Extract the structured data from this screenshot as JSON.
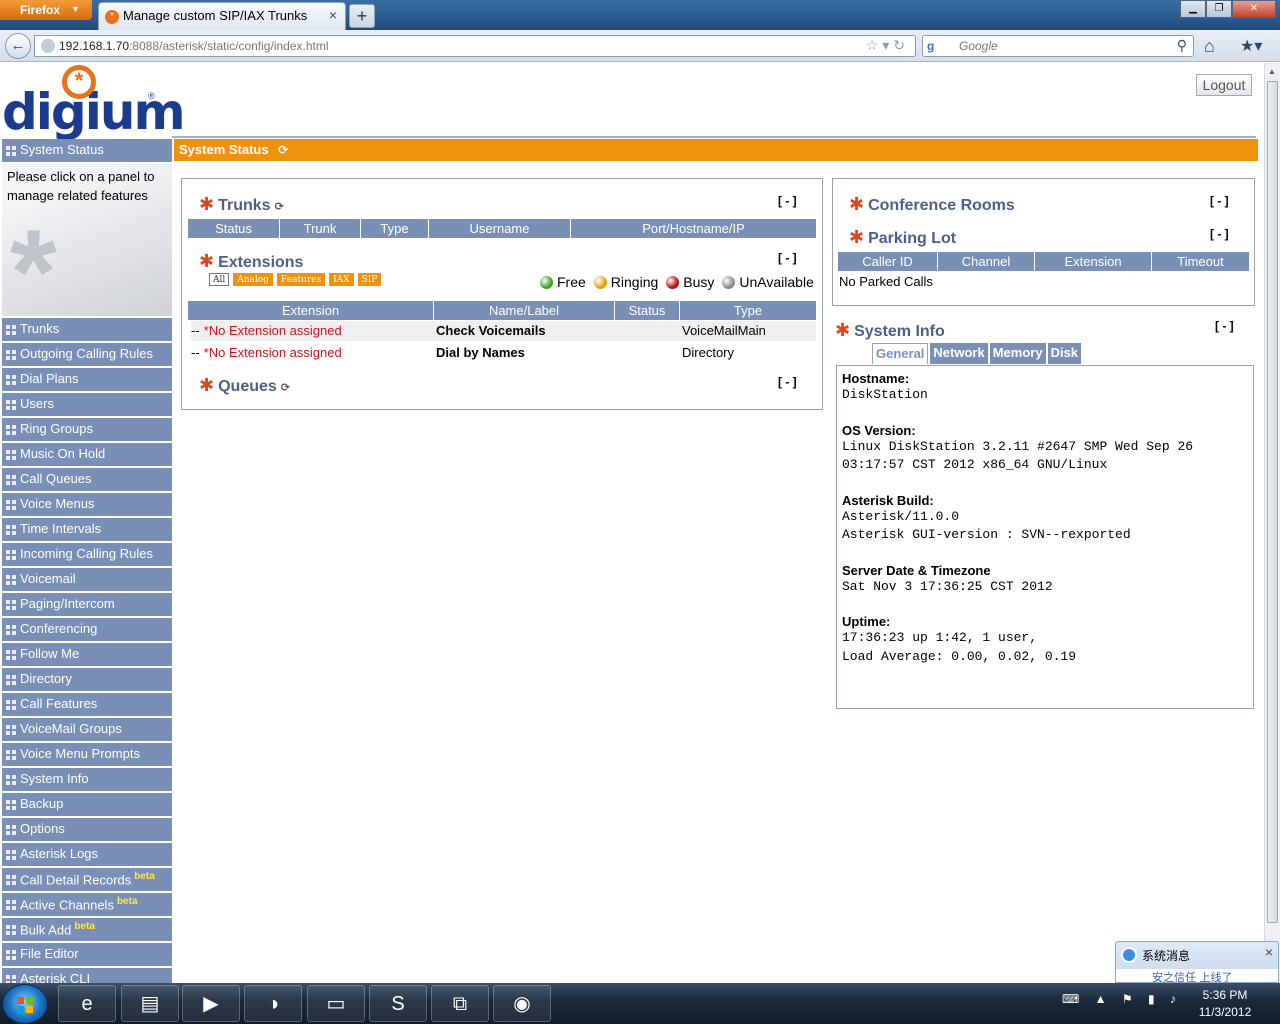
{
  "browser": {
    "menu_button": "Firefox",
    "tab_title": "Manage custom SIP/IAX Trunks",
    "url_host": "192.168.1.70",
    "url_rest": ":8088/asterisk/static/config/index.html",
    "search_placeholder": "Google",
    "search_engine_letter": "g"
  },
  "header": {
    "logo_text": "digium",
    "logout_label": "Logout"
  },
  "sidebar": {
    "active_item": "System Status",
    "help_text": "Please click on a panel to manage related features",
    "items": [
      {
        "label": "Trunks"
      },
      {
        "label": "Outgoing Calling Rules"
      },
      {
        "label": "Dial Plans"
      },
      {
        "label": "Users"
      },
      {
        "label": "Ring Groups"
      },
      {
        "label": "Music On Hold"
      },
      {
        "label": "Call Queues"
      },
      {
        "label": "Voice Menus"
      },
      {
        "label": "Time Intervals"
      },
      {
        "label": "Incoming Calling Rules"
      },
      {
        "label": "Voicemail"
      },
      {
        "label": "Paging/Intercom"
      },
      {
        "label": "Conferencing"
      },
      {
        "label": "Follow Me"
      },
      {
        "label": "Directory"
      },
      {
        "label": "Call Features"
      },
      {
        "label": "VoiceMail Groups"
      },
      {
        "label": "Voice Menu Prompts"
      },
      {
        "label": "System Info"
      },
      {
        "label": "Backup"
      },
      {
        "label": "Options"
      },
      {
        "label": "Asterisk Logs"
      },
      {
        "label": "Call Detail Records",
        "badge": "beta"
      },
      {
        "label": "Active Channels",
        "badge": "beta"
      },
      {
        "label": "Bulk Add",
        "badge": "beta"
      },
      {
        "label": "File Editor"
      },
      {
        "label": "Asterisk CLI"
      }
    ]
  },
  "main": {
    "section_title": "System Status",
    "collapse_label": "[ - ]",
    "trunks": {
      "title": "Trunks",
      "columns": [
        "Status",
        "Trunk",
        "Type",
        "Username",
        "Port/Hostname/IP"
      ]
    },
    "extensions": {
      "title": "Extensions",
      "filters": [
        "All",
        "Analog",
        "Features",
        "IAX",
        "SIP"
      ],
      "legend": [
        {
          "label": "Free",
          "color": "#3aa317"
        },
        {
          "label": "Ringing",
          "color": "#e8a010"
        },
        {
          "label": "Busy",
          "color": "#b3110b"
        },
        {
          "label": "UnAvailable",
          "color": "#8a8a8a"
        }
      ],
      "columns": [
        "Extension",
        "Name/Label",
        "Status",
        "Type"
      ],
      "rows": [
        {
          "prefix": "--",
          "extension": "*No Extension assigned",
          "name": "Check Voicemails",
          "status": "",
          "type": "VoiceMailMain"
        },
        {
          "prefix": "--",
          "extension": "*No Extension assigned",
          "name": "Dial by Names",
          "status": "",
          "type": "Directory"
        }
      ]
    },
    "queues": {
      "title": "Queues"
    },
    "conference": {
      "title": "Conference Rooms"
    },
    "parking": {
      "title": "Parking Lot",
      "columns": [
        "Caller ID",
        "Channel",
        "Extension",
        "Timeout"
      ],
      "empty_text": "No Parked Calls"
    },
    "system_info": {
      "title": "System Info",
      "tabs": [
        "General",
        "Network",
        "Memory",
        "Disk"
      ],
      "active_tab": "General",
      "sections": [
        {
          "label": "Hostname:",
          "value": "DiskStation"
        },
        {
          "label": "OS Version:",
          "value": "Linux DiskStation 3.2.11 #2647 SMP Wed Sep 26\n03:17:57 CST 2012 x86_64 GNU/Linux"
        },
        {
          "label": "Asterisk Build:",
          "value": "Asterisk/11.0.0\nAsterisk GUI-version : SVN--rexported"
        },
        {
          "label": "Server Date & Timezone",
          "value": "Sat Nov 3 17:36:25 CST 2012"
        },
        {
          "label": "Uptime:",
          "value": "17:36:23 up 1:42, 1 user,\nLoad Average: 0.00, 0.02, 0.19"
        }
      ]
    }
  },
  "popup": {
    "title": "系统消息",
    "body": "安之信任 上线了"
  },
  "taskbar": {
    "time": "5:36 PM",
    "date": "11/3/2012"
  },
  "colors": {
    "accent_orange": "#f0910e",
    "nav_blue": "#7a8fb5",
    "title_blue": "#4c5f8a",
    "error_red": "#d5101d"
  }
}
